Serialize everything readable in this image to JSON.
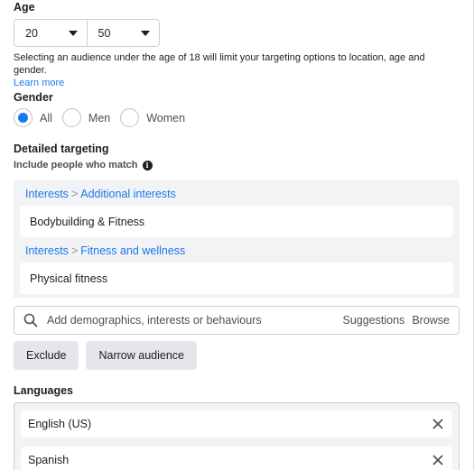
{
  "age": {
    "title": "Age",
    "min": "20",
    "max": "50",
    "note": "Selecting an audience under the age of 18 will limit your targeting options to location, age and gender.",
    "learn_more": "Learn more"
  },
  "gender": {
    "title": "Gender",
    "selected": "All",
    "options": [
      {
        "label": "All",
        "checked": true
      },
      {
        "label": "Men",
        "checked": false
      },
      {
        "label": "Women",
        "checked": false
      }
    ]
  },
  "detailed_targeting": {
    "title": "Detailed targeting",
    "subtitle": "Include people who match",
    "groups": [
      {
        "path": [
          "Interests",
          "Additional interests"
        ],
        "items": [
          "Bodybuilding & Fitness"
        ]
      },
      {
        "path": [
          "Interests",
          "Fitness and wellness"
        ],
        "items": [
          "Physical fitness"
        ]
      }
    ],
    "separator": ">",
    "search_placeholder": "Add demographics, interests or behaviours",
    "suggestions_label": "Suggestions",
    "browse_label": "Browse",
    "exclude_label": "Exclude",
    "narrow_label": "Narrow audience"
  },
  "languages": {
    "title": "Languages",
    "items": [
      "English (US)",
      "Spanish"
    ]
  },
  "colors": {
    "accent": "#1877f2",
    "text": "#1c1e21",
    "muted": "#4b4f56",
    "panel": "#f2f3f5",
    "button": "#e4e6eb",
    "border": "#ccd0d5"
  },
  "icons": {
    "dropdown": "caret-down-icon",
    "info": "info-icon",
    "search": "search-icon",
    "remove": "close-icon"
  }
}
